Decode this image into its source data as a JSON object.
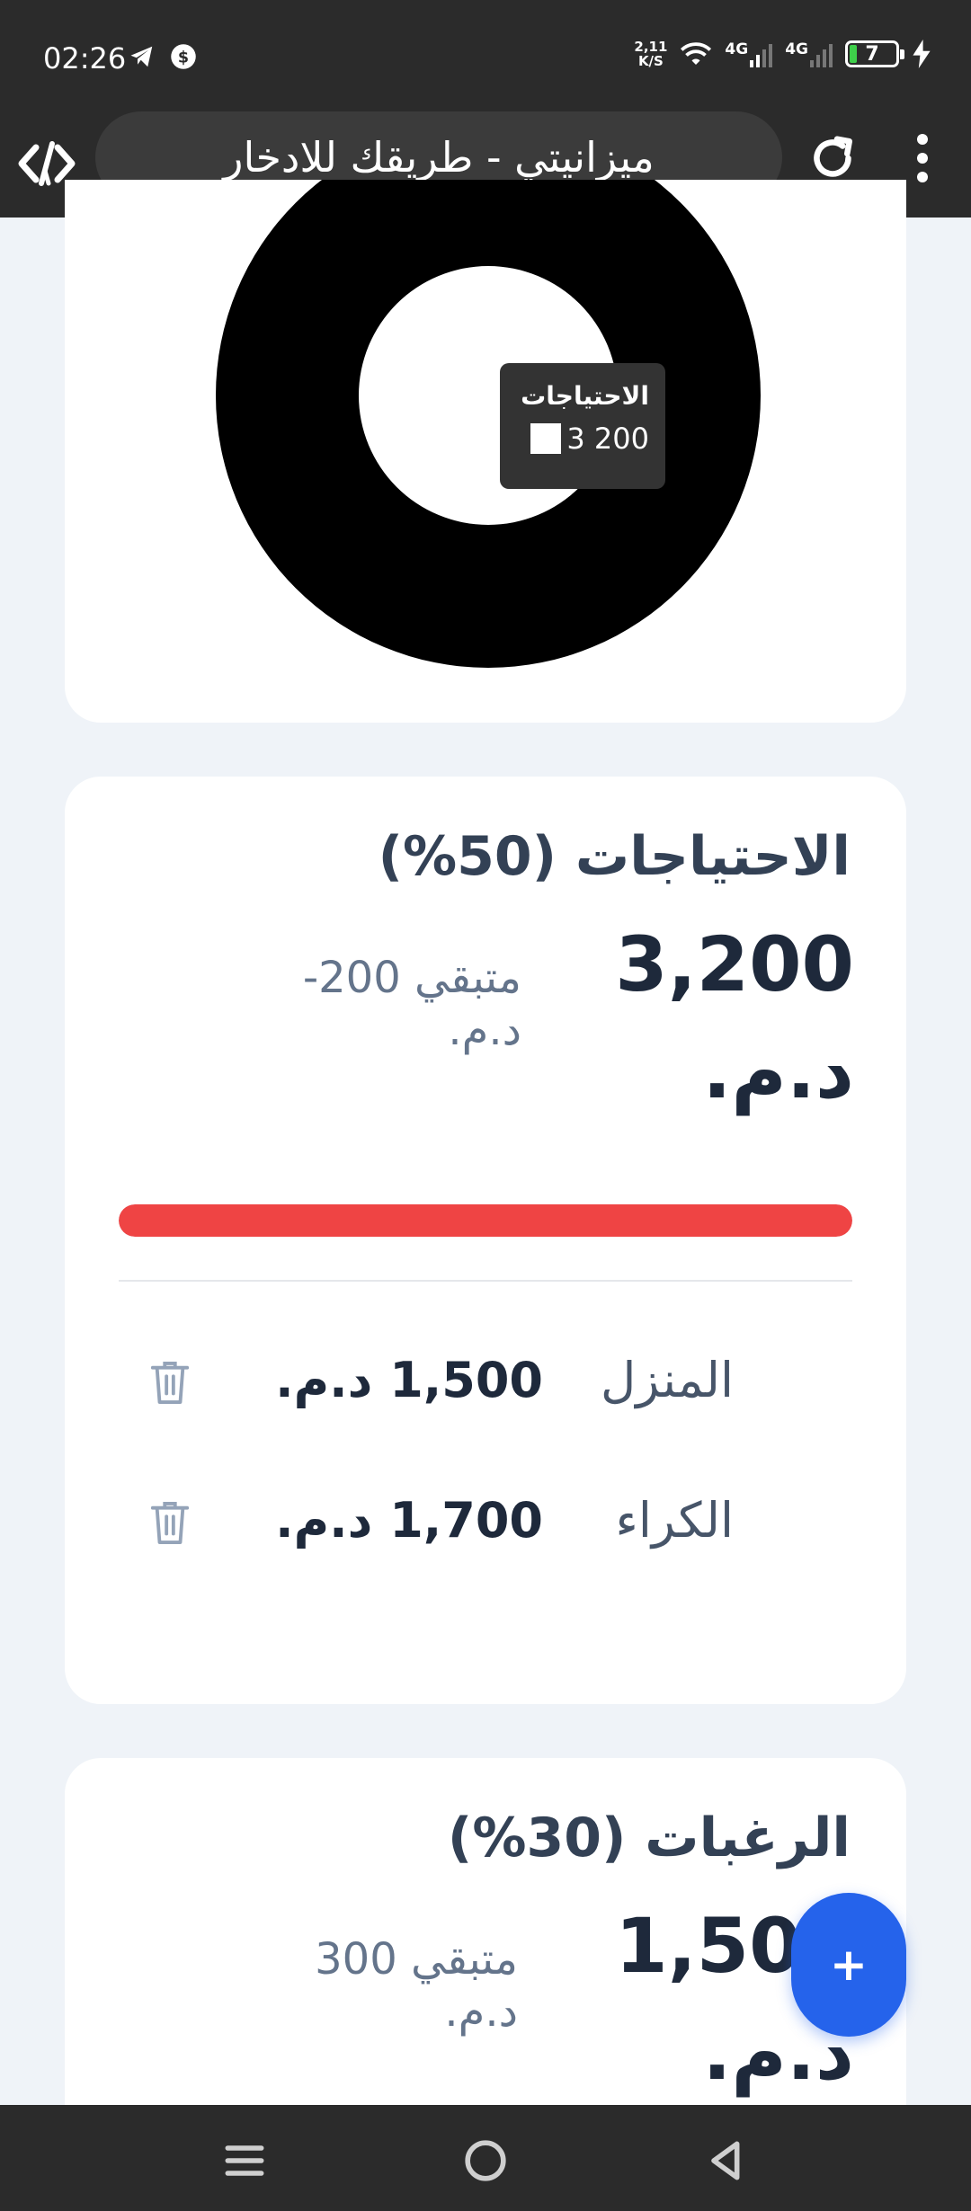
{
  "status_bar": {
    "time": "02:26",
    "net_speed_value": "2,11",
    "net_speed_unit": "K/S",
    "sim1_label": "4G",
    "sim2_label": "4G",
    "battery_level": "7"
  },
  "browser": {
    "page_title": "ميزانيتي - طريقك للادخار"
  },
  "chart_data": {
    "type": "pie",
    "categories": [
      "الاحتياجات"
    ],
    "values": [
      3200
    ],
    "tooltip": {
      "label": "الاحتياجات",
      "value": "3 200"
    },
    "colors": [
      "#000000"
    ]
  },
  "needs": {
    "title": "الاحتياجات (50%)",
    "amount": "3,200 د.م.",
    "remaining": "متبقي 200- د.م.",
    "progress_percent": 100,
    "progress_color": "#ef4444",
    "items": [
      {
        "name": "المنزل",
        "amount": "1,500 د.م."
      },
      {
        "name": "الكراء",
        "amount": "1,700 د.م."
      }
    ]
  },
  "wants": {
    "title": "الرغبات (30%)",
    "amount": "1,500 د.م.",
    "remaining": "متبقي 300 د.م."
  },
  "fab": {
    "label": "+",
    "color": "#2563eb"
  },
  "colors": {
    "background": "#eff3f8",
    "card": "#ffffff",
    "system_bars": "#2b2b2b"
  }
}
